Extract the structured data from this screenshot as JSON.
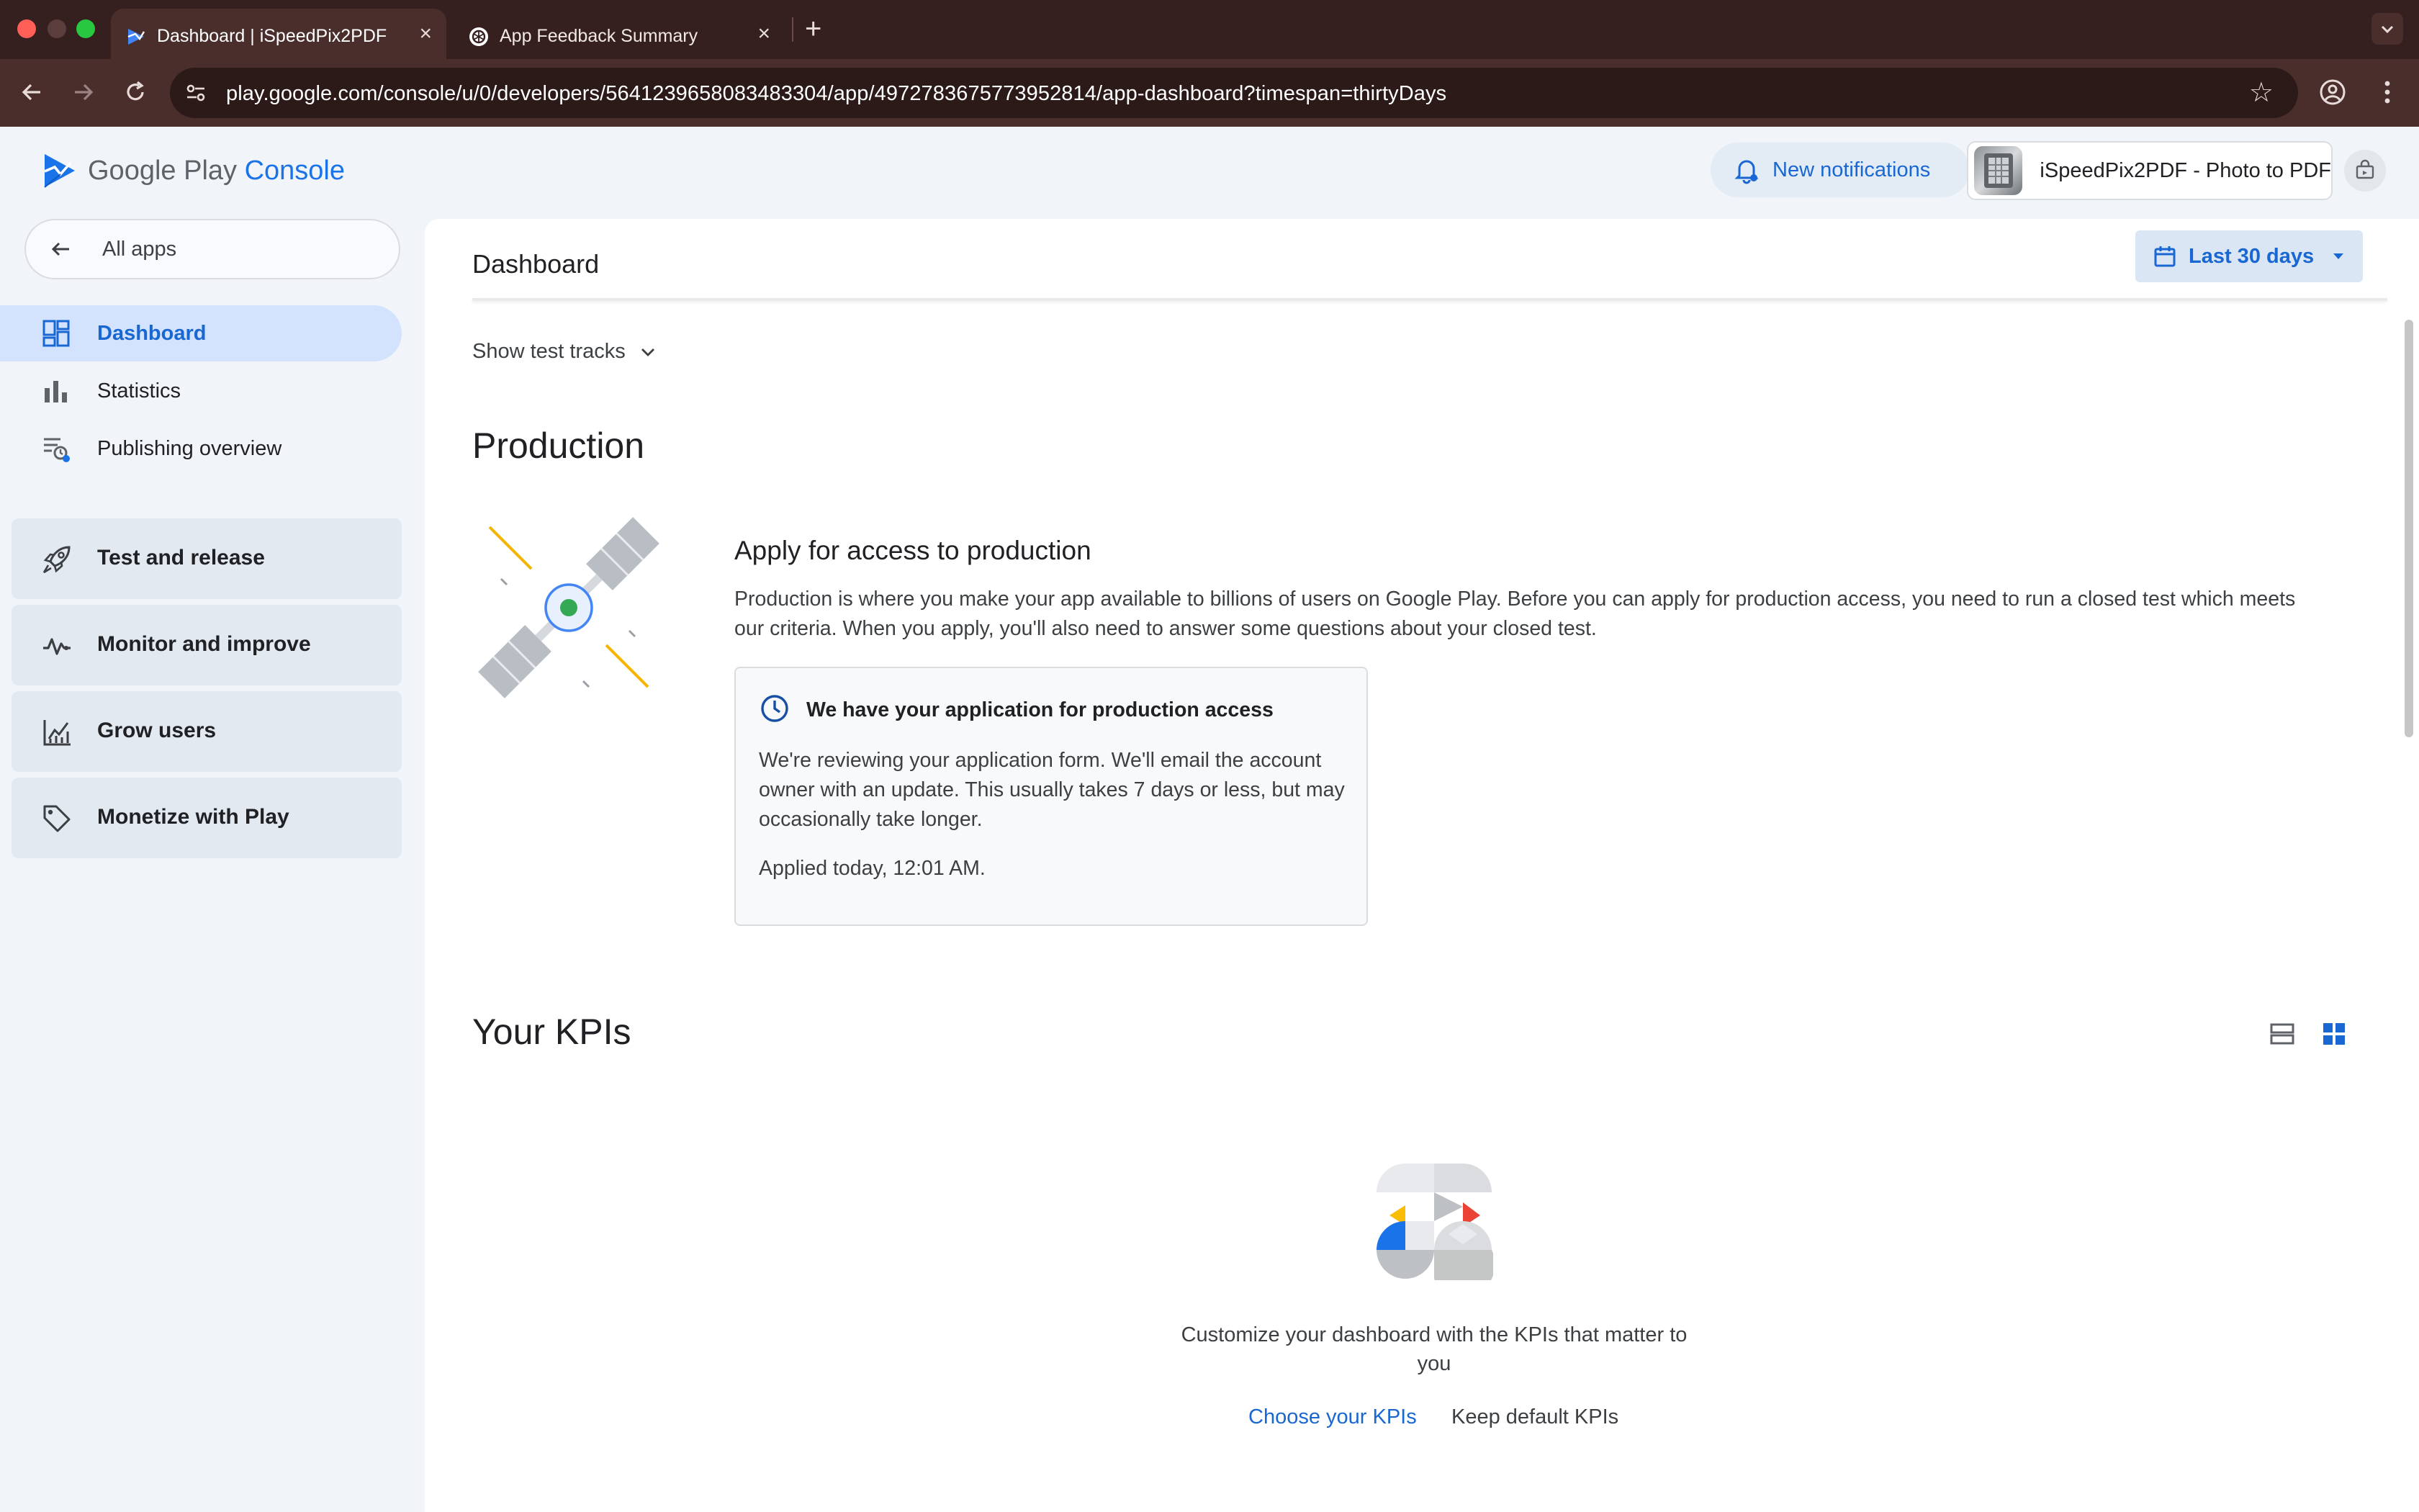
{
  "browser": {
    "tabs": [
      {
        "title": "Dashboard | iSpeedPix2PDF -",
        "active": true
      },
      {
        "title": "App Feedback Summary",
        "active": false
      }
    ],
    "url": "play.google.com/console/u/0/developers/5641239658083483304/app/4972783675773952814/app-dashboard?timespan=thirtyDays",
    "close_glyph": "×",
    "new_tab_glyph": "+"
  },
  "header": {
    "logo_google_play": "Google Play",
    "logo_console": "Console",
    "notifications_label": "New notifications",
    "app_name": "iSpeedPix2PDF - Photo to PDF"
  },
  "sidebar": {
    "all_apps": "All apps",
    "items": [
      {
        "label": "Dashboard",
        "icon": "dashboard-icon",
        "active": true
      },
      {
        "label": "Statistics",
        "icon": "bar-chart-icon",
        "active": false
      },
      {
        "label": "Publishing overview",
        "icon": "publishing-overview-icon",
        "active": false
      }
    ],
    "sections": [
      {
        "label": "Test and release",
        "icon": "rocket-icon"
      },
      {
        "label": "Monitor and improve",
        "icon": "vitals-icon"
      },
      {
        "label": "Grow users",
        "icon": "grow-chart-icon"
      },
      {
        "label": "Monetize with Play",
        "icon": "tag-icon"
      }
    ]
  },
  "main": {
    "title": "Dashboard",
    "date_range": "Last 30 days",
    "show_test_tracks": "Show test tracks",
    "production": {
      "heading": "Production",
      "apply_title": "Apply for access to production",
      "apply_desc": "Production is where you make your app available to billions of users on Google Play. Before you can apply for production access, you need to run a closed test which meets our criteria. When you apply, you'll also need to answer some questions about your closed test.",
      "card_title": "We have your application for production access",
      "card_body": "We're reviewing your application form. We'll email the account owner with an update. This usually takes 7 days or less, but may occasionally take longer.",
      "card_applied": "Applied today, 12:01 AM."
    },
    "kpis": {
      "heading": "Your KPIs",
      "empty_text": "Customize your dashboard with the KPIs that matter to you",
      "choose_link": "Choose your KPIs",
      "keep_link": "Keep default KPIs"
    }
  },
  "colors": {
    "accent": "#1967d2",
    "nav_active_bg": "#d3e3fd",
    "tabstrip_bg": "#35201f",
    "toolbar_bg": "#4a2e2c"
  }
}
